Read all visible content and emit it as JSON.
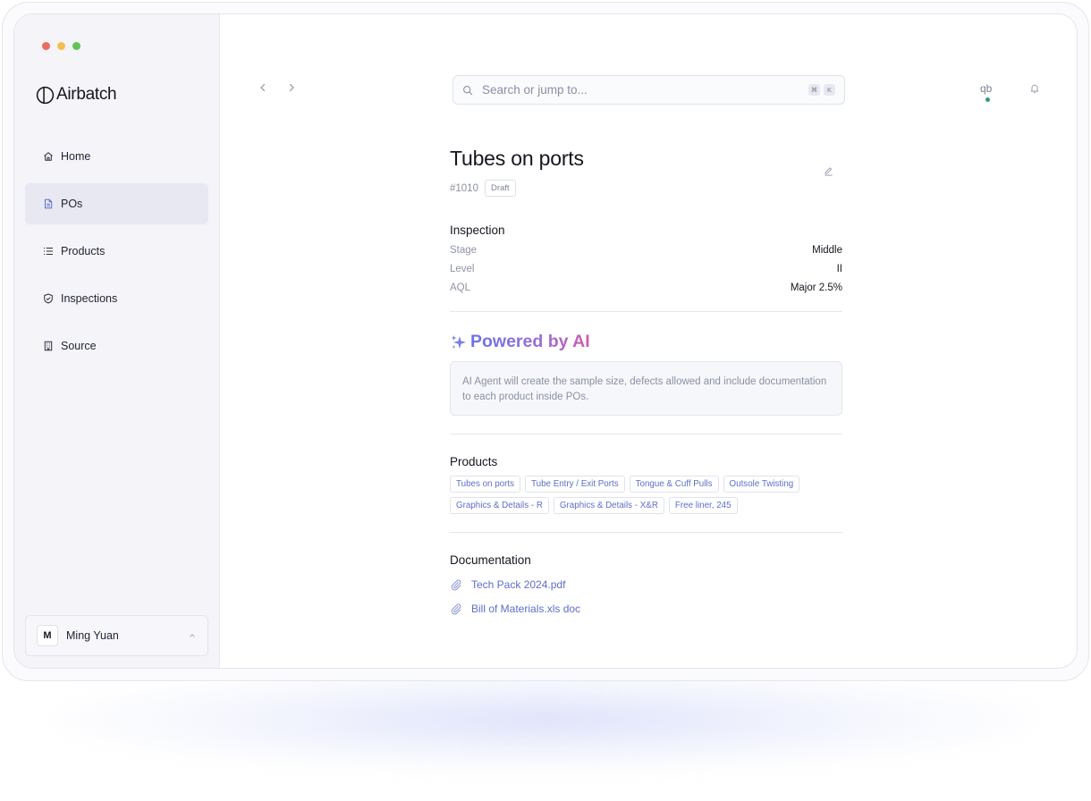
{
  "app": {
    "name": "Airbatch"
  },
  "colors": {
    "accent": "#5e6fc7",
    "traffic_red": "#ec6a5e",
    "traffic_yellow": "#f4bf4f",
    "traffic_green": "#61c554",
    "status_green": "#2aa06a"
  },
  "sidebar": {
    "items": [
      {
        "label": "Home",
        "icon": "home-icon"
      },
      {
        "label": "POs",
        "icon": "document-icon",
        "active": true
      },
      {
        "label": "Products",
        "icon": "list-icon"
      },
      {
        "label": "Inspections",
        "icon": "shield-check-icon"
      },
      {
        "label": "Source",
        "icon": "building-icon"
      }
    ],
    "user": {
      "initial": "M",
      "name": "Ming Yuan"
    }
  },
  "header": {
    "search_placeholder": "Search or jump to...",
    "shortcut": [
      "⌘",
      "K"
    ],
    "integration": "qb"
  },
  "po": {
    "title": "Tubes on ports",
    "id": "#1010",
    "status": "Draft"
  },
  "inspection": {
    "title": "Inspection",
    "rows": [
      {
        "key": "Stage",
        "value": "Middle"
      },
      {
        "key": "Level",
        "value": "II"
      },
      {
        "key": "AQL",
        "value": "Major 2.5%"
      }
    ]
  },
  "ai": {
    "title": "Powered by AI",
    "description": "AI Agent will create the sample size, defects allowed and include documentation to each product inside POs."
  },
  "products": {
    "title": "Products",
    "tags": [
      "Tubes on ports",
      "Tube Entry / Exit Ports",
      "Tongue & Cuff Pulls",
      "Outsole Twisting",
      "Graphics & Details - R",
      "Graphics & Details - X&R",
      "Free liner, 245"
    ]
  },
  "documentation": {
    "title": "Documentation",
    "files": [
      "Tech Pack 2024.pdf",
      "Bill of Materials.xls doc"
    ]
  }
}
